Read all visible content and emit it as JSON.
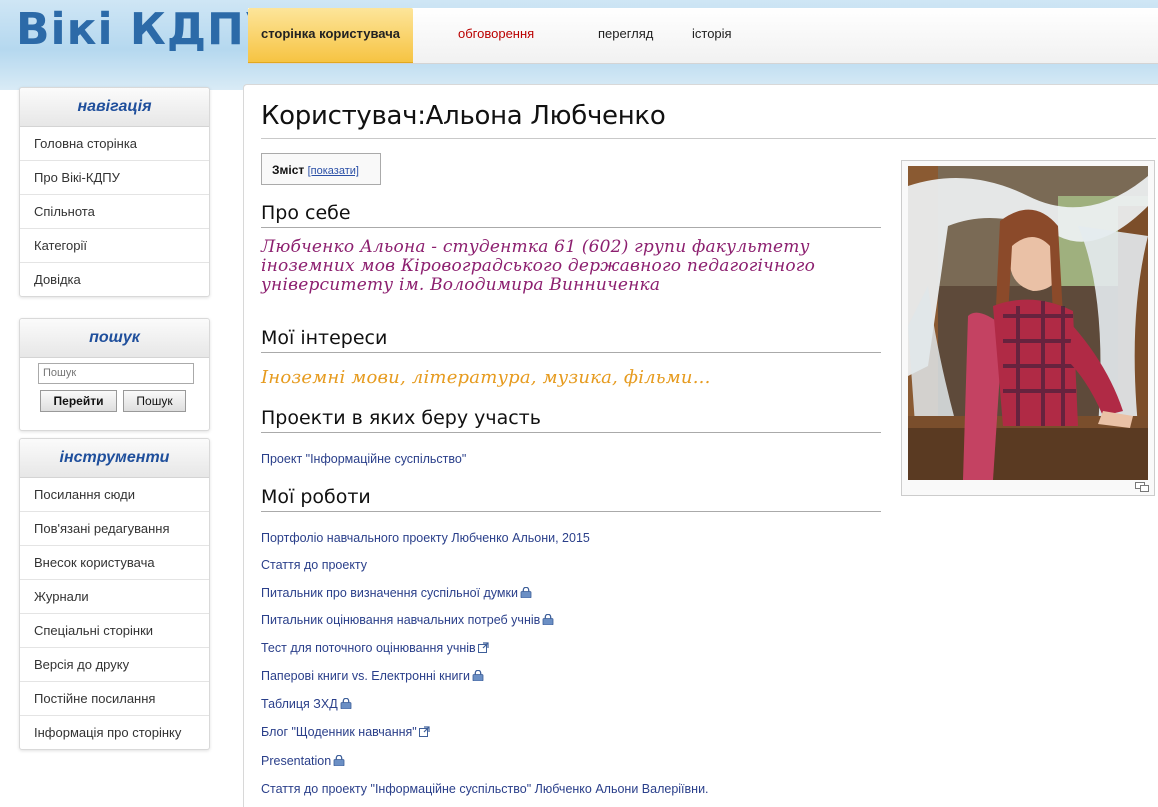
{
  "logo": "Вікі КДПУ",
  "tabs": {
    "user_page": "сторінка користувача",
    "talk": "обговорення",
    "view": "перегляд",
    "history": "історія"
  },
  "navigation": {
    "title": "навігація",
    "items": [
      "Головна сторінка",
      "Про Вікі-КДПУ",
      "Спільнота",
      "Категорії",
      "Довідка"
    ]
  },
  "search": {
    "title": "пошук",
    "placeholder": "Пошук",
    "go_label": "Перейти",
    "search_label": "Пошук"
  },
  "tools": {
    "title": "інструменти",
    "items": [
      "Посилання сюди",
      "Пов'язані редагування",
      "Внесок користувача",
      "Журнали",
      "Спеціальні сторінки",
      "Версія до друку",
      "Постійне посилання",
      "Інформація про сторінку"
    ]
  },
  "page": {
    "title": "Користувач:Альона Любченко",
    "toc_label": "Зміст",
    "toc_toggle": "[показати]",
    "about_heading": "Про себе",
    "about_text": "Любченко Альона - студентка 61 (602) групи факультету іноземних мов Кіровоградського державного педагогічного університету ім. Володимира Винниченка",
    "interests_heading": "Мої інтереси",
    "interests_text": "Іноземні мови, література, музика, фільми...",
    "projects_heading": "Проекти в яких беру участь",
    "projects": [
      "Проект \"Інформаційне суспільство\""
    ],
    "works_heading": "Мої роботи",
    "works": [
      {
        "text": "Портфоліо навчального проекту Любченко Альони, 2015",
        "icon": "none"
      },
      {
        "text": "Стаття до проекту",
        "icon": "none"
      },
      {
        "text": "Питальник про визначення суспільної думки",
        "icon": "lock-icon"
      },
      {
        "text": "Питальник оцінювання навчальних потреб учнів",
        "icon": "lock-icon"
      },
      {
        "text": "Тест для поточного оцінювання учнів",
        "icon": "external-link-icon"
      },
      {
        "text": "Паперові книги vs. Електронні книги",
        "icon": "lock-icon"
      },
      {
        "text": "Таблиця ЗХД",
        "icon": "lock-icon"
      },
      {
        "text": "Блог \"Щоденник навчання\"",
        "icon": "external-link-icon"
      },
      {
        "text": "Presentation",
        "icon": "lock-icon"
      },
      {
        "text": "Стаття до проекту \"Інформаційне суспільство\" Любченко Альони Валеріївни.",
        "icon": "none"
      }
    ]
  },
  "colors": {
    "accent_blue": "#2c6aa8",
    "link": "#2a3f8a",
    "script_purple": "#8c1f6f",
    "script_orange": "#e69b1f",
    "active_tab": "#f6c341"
  }
}
